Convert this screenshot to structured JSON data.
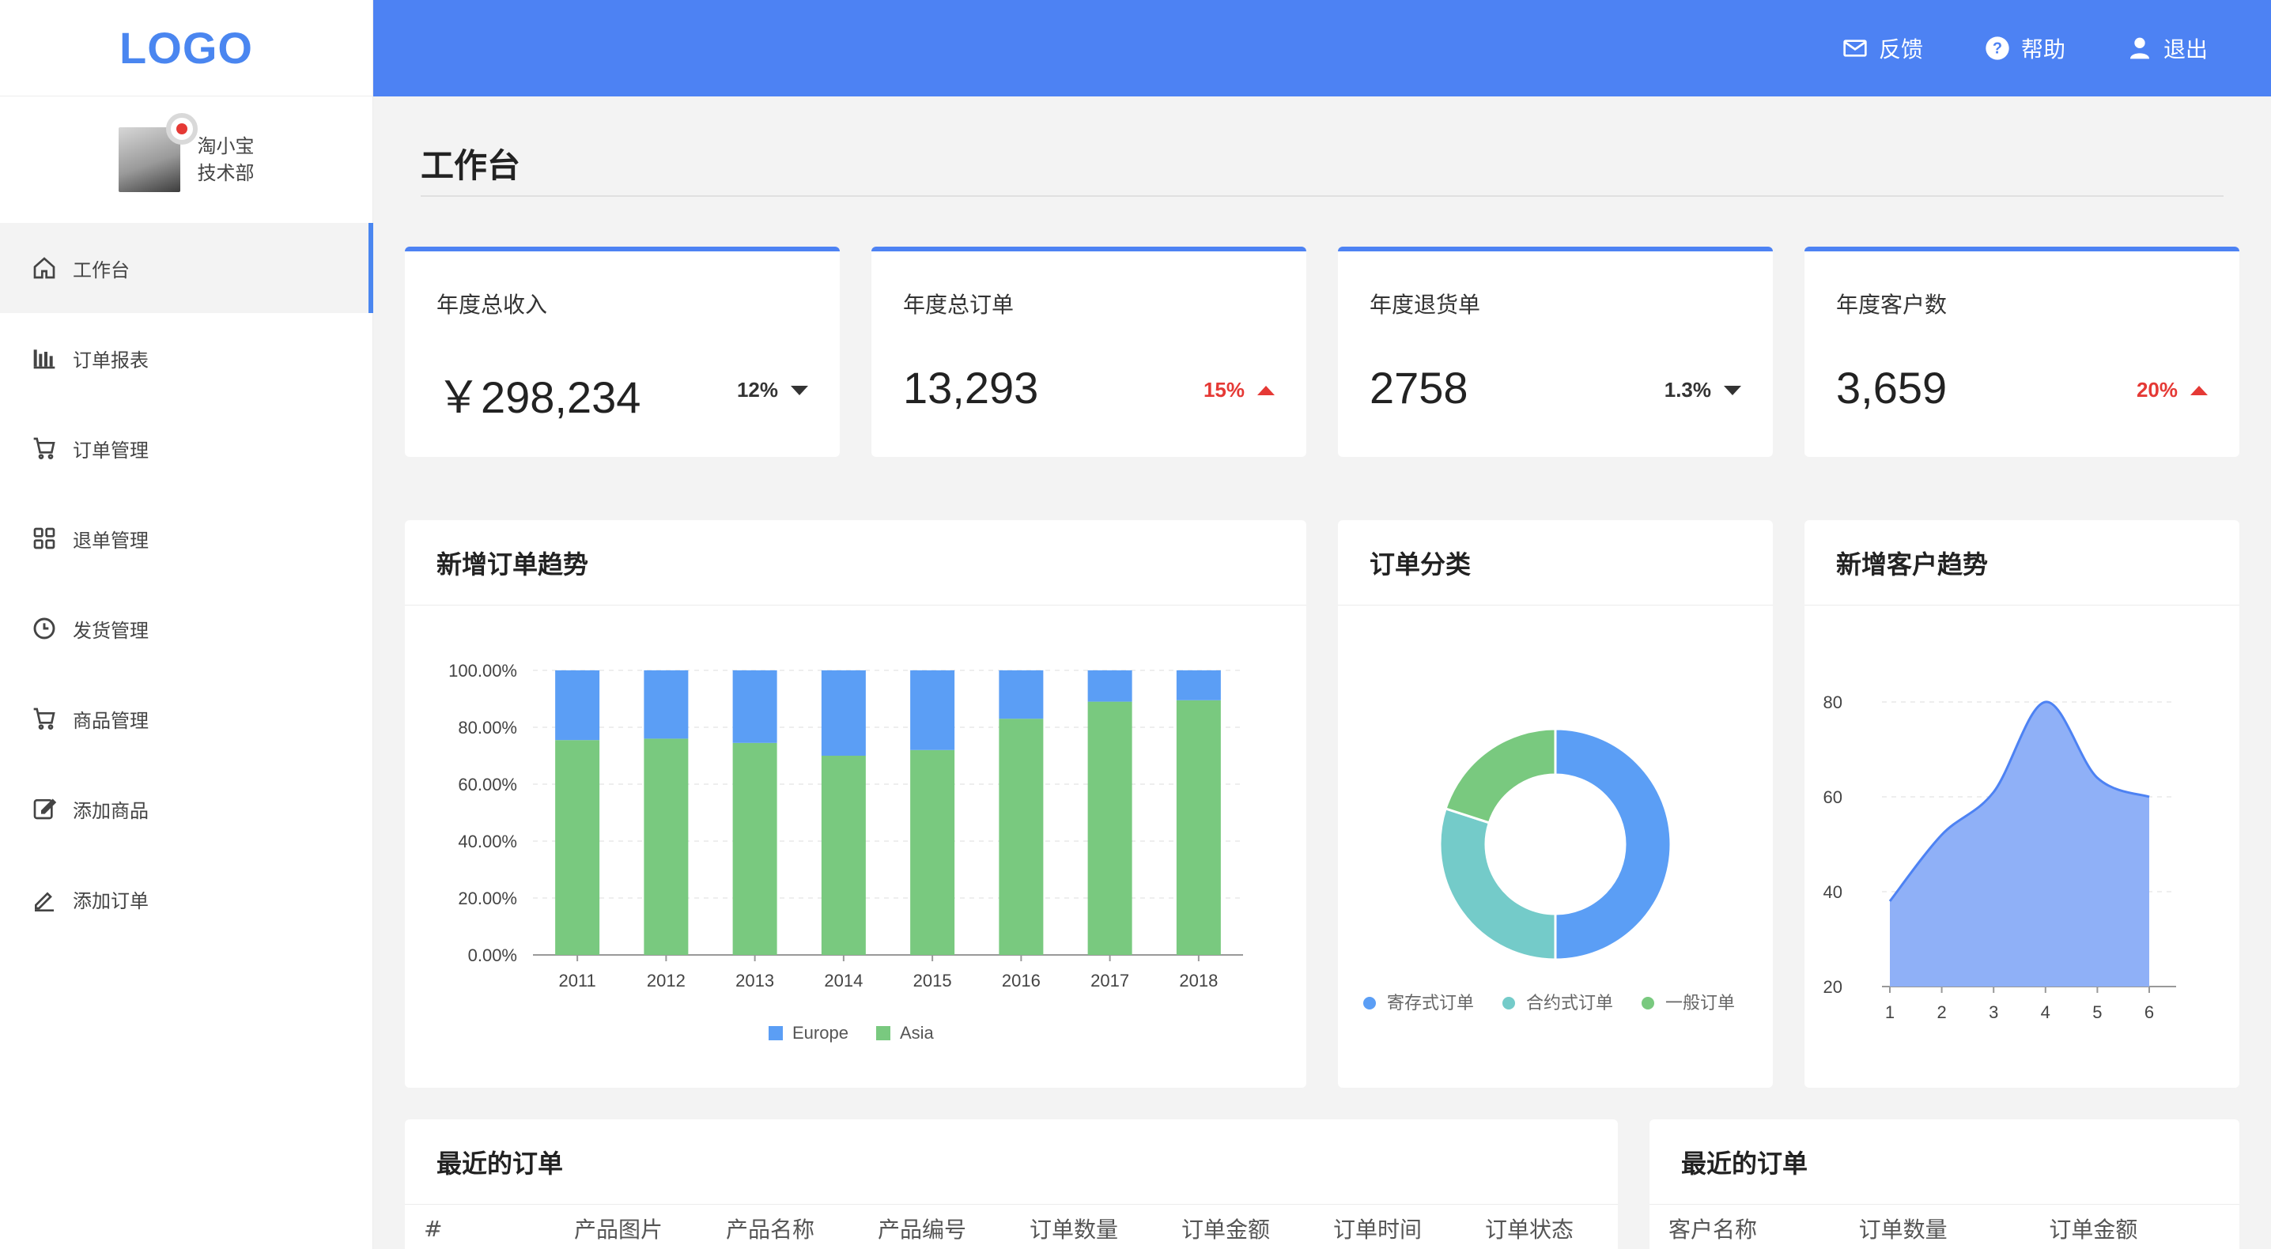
{
  "logo": "LOGO",
  "user": {
    "name": "淘小宝",
    "dept": "技术部"
  },
  "menu": [
    {
      "label": "工作台",
      "icon": "home-icon",
      "active": true
    },
    {
      "label": "订单报表",
      "icon": "bar-chart-icon"
    },
    {
      "label": "订单管理",
      "icon": "cart-icon"
    },
    {
      "label": "退单管理",
      "icon": "grid-icon"
    },
    {
      "label": "发货管理",
      "icon": "clock-icon"
    },
    {
      "label": "商品管理",
      "icon": "cart-icon"
    },
    {
      "label": "添加商品",
      "icon": "edit-icon"
    },
    {
      "label": "添加订单",
      "icon": "pen-icon"
    }
  ],
  "header": {
    "feedback": "反馈",
    "help": "帮助",
    "logout": "退出",
    "color": "#4d82f3"
  },
  "page_title": "工作台",
  "stats": [
    {
      "label": "年度总收入",
      "value": "￥298,234",
      "change": "12%",
      "trend": "down"
    },
    {
      "label": "年度总订单",
      "value": "13,293",
      "change": "15%",
      "trend": "up"
    },
    {
      "label": "年度退货单",
      "value": "2758",
      "change": "1.3%",
      "trend": "down"
    },
    {
      "label": "年度客户数",
      "value": "3,659",
      "change": "20%",
      "trend": "up"
    }
  ],
  "panels": {
    "order_trend": "新增订单趋势",
    "order_category": "订单分类",
    "customer_trend": "新增客户趋势",
    "recent_orders": "最近的订单",
    "recent_orders_2": "最近的订单"
  },
  "chart_data": [
    {
      "type": "bar",
      "stacked": true,
      "categories": [
        "2011",
        "2012",
        "2013",
        "2014",
        "2015",
        "2016",
        "2017",
        "2018"
      ],
      "series": [
        {
          "name": "Asia",
          "color": "#79c97f",
          "values": [
            75.5,
            76,
            74.5,
            70,
            72,
            83,
            89,
            89.5
          ]
        },
        {
          "name": "Europe",
          "color": "#5b9ef5",
          "values": [
            24.5,
            24,
            25.5,
            30,
            28,
            17,
            11,
            10.5
          ]
        }
      ],
      "ylim": [
        0,
        100
      ],
      "yticks": [
        "0.00%",
        "20.00%",
        "40.00%",
        "60.00%",
        "80.00%",
        "100.00%"
      ],
      "legend": [
        "Europe",
        "Asia"
      ],
      "legend_position": "bottom"
    },
    {
      "type": "pie",
      "donut": true,
      "slices": [
        {
          "name": "寄存式订单",
          "value": 50,
          "color": "#5b9ef5"
        },
        {
          "name": "合约式订单",
          "value": 30,
          "color": "#74cbc9"
        },
        {
          "name": "一般订单",
          "value": 20,
          "color": "#79c97f"
        }
      ],
      "legend_position": "bottom"
    },
    {
      "type": "area",
      "x": [
        1,
        2,
        3,
        4,
        5,
        6
      ],
      "series": [
        {
          "values": [
            38,
            52,
            61,
            80,
            64,
            60
          ],
          "color": "#4d82f3"
        }
      ],
      "ylim": [
        20,
        80
      ],
      "yticks": [
        20,
        40,
        60,
        80
      ],
      "grid": true
    }
  ],
  "table1": {
    "headers": [
      "#",
      "产品图片",
      "产品名称",
      "产品编号",
      "订单数量",
      "订单金额",
      "订单时间",
      "订单状态"
    ]
  },
  "table2": {
    "headers": [
      "客户名称",
      "订单数量",
      "订单金额"
    ]
  }
}
